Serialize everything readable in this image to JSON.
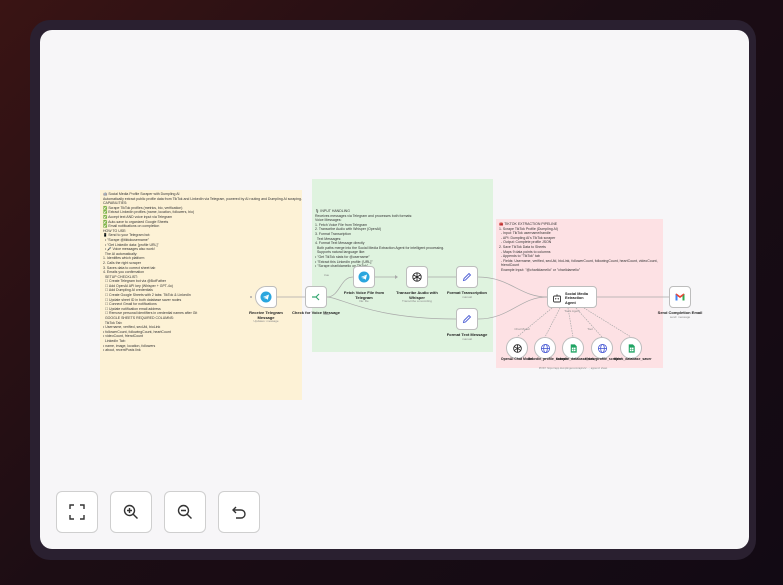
{
  "colors": {
    "accent": "#e8eaf6",
    "telegram": "#2aa6de",
    "openai": "#222222",
    "sheets": "#1fa463",
    "gmail": "#ea4335",
    "note_yellow": "#fdf2d6",
    "note_green": "#dff3df",
    "note_pink": "#fde1e4"
  },
  "notes": {
    "yellow": [
      "🤖 Social Media Profile Scraper with Dumpling AI",
      "",
      "Automatically extract public profile data from TikTok and LinkedIn via Telegram, powered by AI routing and Dumpling AI scraping.",
      "",
      "CAPABILITIES:",
      "✅ Scrape TikTok profiles (metrics, bio, verification)",
      "✅ Extract LinkedIn profiles (name, location, followers, bio)",
      "✅ Accept text AND voice input via Telegram",
      "✅ Auto-save to organized Google Sheets",
      "✅ Email notifications on completion",
      "",
      "HOW TO USE:",
      "📱 Send to your Telegram bot:",
      "  • \"Scrape @tiktokusername\"",
      "  • \"Get LinkedIn data: [profile URL]\"",
      "  • 🎤 Voice messages also work!",
      "",
      "  The AI automatically:",
      "1. Identifies which platform",
      "2. Calls the right scraper",
      "3. Saves data to correct sheet tab",
      "4. Emails you confirmation",
      "",
      "  SETUP CHECKLIST:",
      "  ☐ Create Telegram bot via @BotFather",
      "  ☐ Add OpenAI API key (Whisper + GPT-4o)",
      "  ☐ Add Dumpling AI credentials",
      "  ☐ Create Google Sheets with 2 tabs: TikTok & LinkedIn",
      "  ☐ Update sheet ID in both database saver nodes",
      "  ☐ Connect Gmail for notifications",
      "  ☐ Update notification email address",
      "  ☐ Remove personal identifiers in credential names after Git",
      "",
      "  GOOGLE SHEETS REQUIRED COLUMNS:",
      "",
      "  TikTok Tab:",
      "• Username, verified, secUid, bioLink",
      "• followerCount, followingCount, heartCount",
      "• videoCount, friendCount",
      "",
      "  LinkedIn Tab:",
      "• name, image, location, followers",
      "• about, recentPosts link"
    ],
    "green": [
      "🎙 INPUT HANDLING",
      "",
      "Receives messages via Telegram and processes both formats:",
      "",
      "Voice Messages:",
      "1. Fetch Voice File from Telegram",
      "2. Transcribe Audio with Whisper (OpenAI)",
      "3. Format Transcription",
      "",
      "  Text Messages:",
      "4. Format Text Message directly",
      "",
      "  Both paths merge into the Social Media Extraction Agent for intelligent processing.",
      "",
      "  Supports natural language like:",
      "• \"Get TikTok stats for @username\"",
      "• \"Extract this LinkedIn profile: [URL]\"",
      "• \"Scrape charlidamelio on TikTok\""
    ],
    "pink": [
      "🧰 TIKTOK EXTRACTION PIPELINE",
      "",
      "1. Scrape TikTok Profile (Dumpling AI)",
      "  - Input: TikTok username/handle",
      "  - API: Dumpling AI's TikTok scraper",
      "  - Output: Complete profile JSON",
      "",
      "2. Save TikTok Data to Sheets",
      "  - Maps 9 data points to columns",
      "  - Appends to \"TikTok\" tab",
      "  - Fields: Username, verified, secUid, bioLink, followerCount, followingCount, heartCount, videoCount,",
      "  friendCount",
      "",
      "  Example Input: \"@charlidamelio\" or \"charlidamelio\""
    ]
  },
  "nodes": {
    "receive": {
      "title": "Receive Telegram Message",
      "sub": "Updates: message"
    },
    "check": {
      "title": "Check for Voice Message"
    },
    "fetch": {
      "title": "Fetch Voice File from Telegram",
      "sub": "file: file"
    },
    "transcribe": {
      "title": "Transcribe Audio with Whisper",
      "sub": "Transcribe a recording"
    },
    "format_trans": {
      "title": "Format Transcription",
      "sub": "manual"
    },
    "format_text": {
      "title": "Format Text Message",
      "sub": "manual"
    },
    "agent": {
      "title": "Social Media Extraction Agent",
      "sub": "Tools Agent"
    },
    "gmail": {
      "title": "Send Completion Email",
      "sub": "send: message"
    }
  },
  "edge_labels": {
    "true": "true",
    "false": "false",
    "memory": "Chat Model",
    "tool": "Tool"
  },
  "subnodes": [
    {
      "title": "OpenAI Chat Model",
      "sub": ""
    },
    {
      "title": "linkedin_profile_scraper",
      "sub": ""
    },
    {
      "title": "linkedin_database_saver",
      "sub": ""
    },
    {
      "title": "tiktok_profile_scraper",
      "sub": ""
    },
    {
      "title": "tiktok_database_saver",
      "sub": ""
    }
  ],
  "subnote": "POST: https://app.dumplingai.com/api/v1/... ; append: sheet",
  "controls": {
    "fit": "fit-view-icon",
    "zoom_in": "zoom-in-icon",
    "zoom_out": "zoom-out-icon",
    "reset": "undo-icon"
  }
}
